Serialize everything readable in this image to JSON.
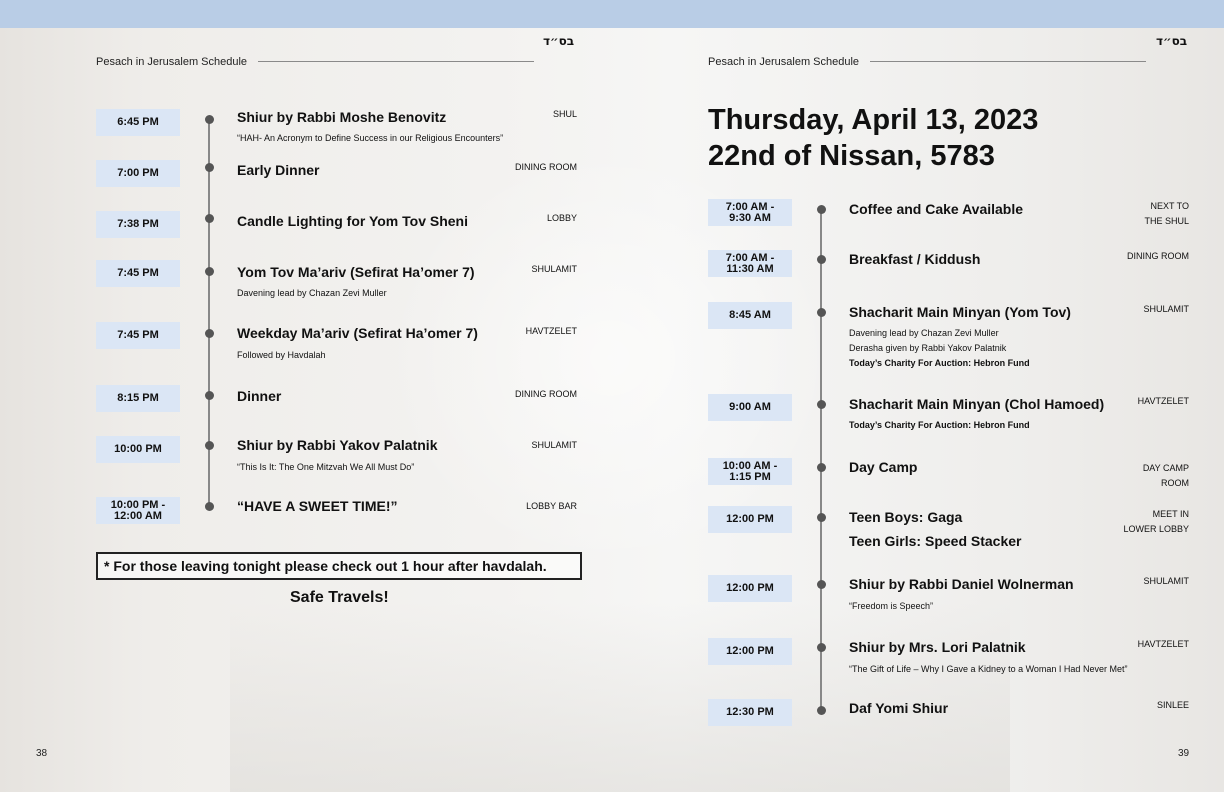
{
  "header": {
    "hebrew": "בס״ד",
    "title": "Pesach in Jerusalem Schedule"
  },
  "left": {
    "page_number": "38",
    "events": [
      {
        "time": "6:45 PM",
        "title": "Shiur by Rabbi Moshe Benovitz",
        "location": "SHUL",
        "subs": [
          "“HAH- An Acronym to Define Success in our Religious Encounters”"
        ]
      },
      {
        "time": "7:00 PM",
        "title": "Early Dinner",
        "location": "DINING ROOM",
        "subs": []
      },
      {
        "time": "7:38 PM",
        "title": "Candle Lighting for Yom Tov Sheni",
        "location": "LOBBY",
        "subs": []
      },
      {
        "time": "7:45 PM",
        "title": "Yom Tov Ma’ariv (Sefirat Ha’omer 7)",
        "location": "SHULAMIT",
        "subs": [
          "Davening lead by Chazan Zevi Muller"
        ]
      },
      {
        "time": "7:45 PM",
        "title": "Weekday Ma’ariv (Sefirat Ha’omer 7)",
        "location": "HAVTZELET",
        "subs": [
          "Followed by Havdalah"
        ]
      },
      {
        "time": "8:15 PM",
        "title": "Dinner",
        "location": "DINING ROOM",
        "subs": []
      },
      {
        "time": "10:00 PM",
        "title": "Shiur by Rabbi Yakov Palatnik",
        "location": "SHULAMIT",
        "subs": [
          "“This Is It: The One Mitzvah We All Must Do”"
        ]
      },
      {
        "time_lines": [
          "10:00 PM -",
          "12:00 AM"
        ],
        "title": "“HAVE A SWEET TIME!”",
        "location": "LOBBY BAR",
        "subs": []
      }
    ],
    "notice": "* For those leaving tonight please check out 1 hour after havdalah.",
    "farewell": "Safe Travels!"
  },
  "right": {
    "page_number": "39",
    "date_line1": "Thursday, April 13, 2023",
    "date_line2": "22nd of Nissan, 5783",
    "events": [
      {
        "time_lines": [
          "7:00 AM -",
          "9:30 AM"
        ],
        "title": "Coffee and Cake Available",
        "location_lines": [
          "NEXT TO",
          "THE SHUL"
        ],
        "subs": []
      },
      {
        "time_lines": [
          "7:00 AM -",
          "11:30 AM"
        ],
        "title": "Breakfast / Kiddush",
        "location": "DINING ROOM",
        "subs": []
      },
      {
        "time": "8:45 AM",
        "title": "Shacharit Main Minyan (Yom Tov)",
        "location": "SHULAMIT",
        "subs": [
          "Davening lead by Chazan Zevi Muller",
          "Derasha given by Rabbi Yakov Palatnik",
          "Today’s Charity For Auction: Hebron Fund"
        ]
      },
      {
        "time": "9:00 AM",
        "title": "Shacharit Main Minyan (Chol Hamoed)",
        "location": "HAVTZELET",
        "subs": [
          "Today’s Charity For Auction: Hebron Fund"
        ]
      },
      {
        "time_lines": [
          "10:00 AM -",
          "1:15 PM"
        ],
        "title": "Day Camp",
        "location_lines": [
          "DAY CAMP",
          "ROOM"
        ],
        "subs": []
      },
      {
        "time": "12:00 PM",
        "title": "Teen Boys: Gaga",
        "title2": "Teen Girls: Speed Stacker",
        "location_lines": [
          "MEET IN",
          "LOWER LOBBY"
        ],
        "subs": []
      },
      {
        "time": "12:00 PM",
        "title": "Shiur by Rabbi Daniel Wolnerman",
        "location": "SHULAMIT",
        "subs": [
          "“Freedom is Speech”"
        ]
      },
      {
        "time": "12:00 PM",
        "title": "Shiur by Mrs. Lori Palatnik",
        "location": "HAVTZELET",
        "subs": [
          "“The Gift of Life – Why I Gave a Kidney to a Woman I Had Never Met”"
        ]
      },
      {
        "time": "12:30 PM",
        "title": "Daf Yomi Shiur",
        "location": "SINLEE",
        "subs": []
      }
    ]
  }
}
